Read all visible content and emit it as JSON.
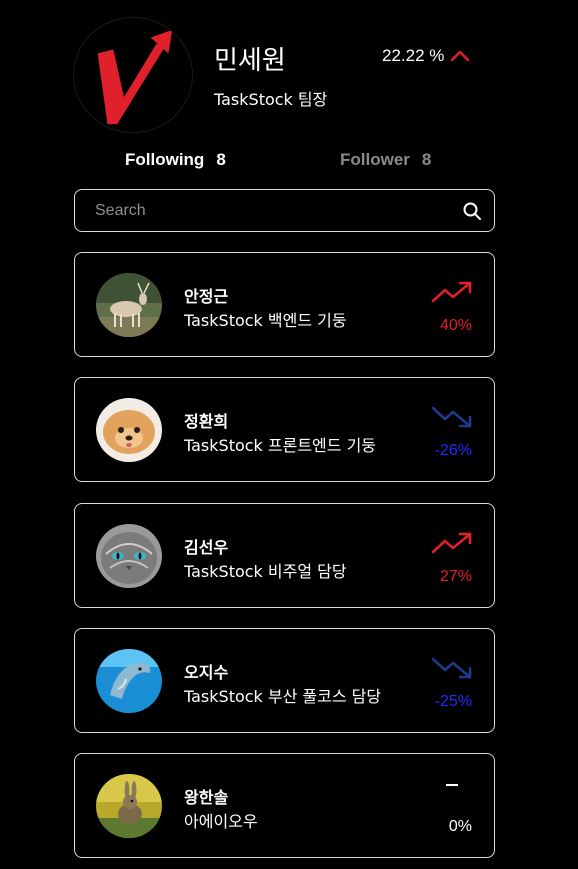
{
  "profile": {
    "name": "민세원",
    "role": "TaskStock 팀장",
    "change": "22.22 %",
    "change_direction": "up"
  },
  "follow": {
    "following_label": "Following",
    "following_count": "8",
    "follower_label": "Follower",
    "follower_count": "8"
  },
  "search": {
    "placeholder": "Search"
  },
  "colors": {
    "up": "#e0202a",
    "down": "#1e2aff",
    "background": "#000000",
    "border": "#d9d9d9"
  },
  "users": [
    {
      "name": "안정근",
      "role": "TaskStock 백엔드 기둥",
      "change": "40%",
      "trend": "up",
      "avatar": "deer"
    },
    {
      "name": "정환희",
      "role": "TaskStock 프론트엔드 기둥",
      "change": "-26%",
      "trend": "down",
      "avatar": "pomeranian"
    },
    {
      "name": "김선우",
      "role": "TaskStock 비주얼 담당",
      "change": "27%",
      "trend": "up",
      "avatar": "cat"
    },
    {
      "name": "오지수",
      "role": "TaskStock 부산 풀코스 담당",
      "change": "-25%",
      "trend": "down",
      "avatar": "dolphin"
    },
    {
      "name": "왕한솔",
      "role": "아에이오우",
      "change": "0%",
      "trend": "flat",
      "avatar": "rabbit"
    }
  ]
}
